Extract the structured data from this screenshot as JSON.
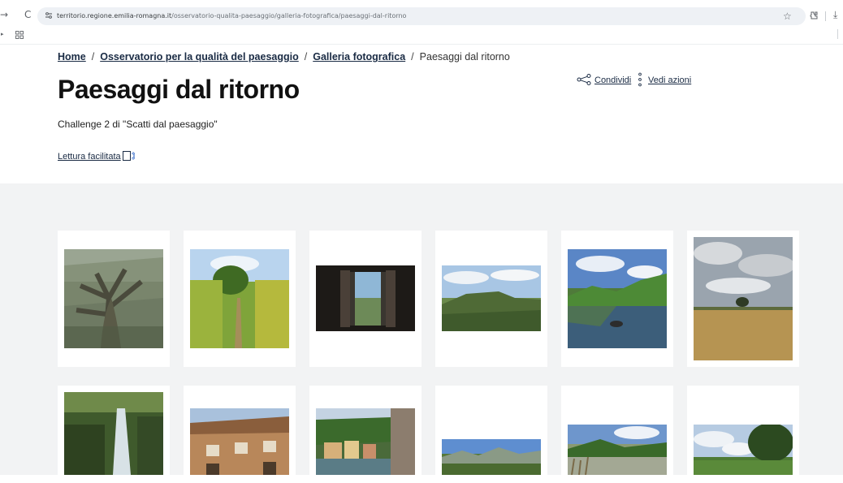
{
  "browser": {
    "back_glyph": "→",
    "reload_glyph": "C",
    "url_host": "territorio.regione.emilia-romagna.it",
    "url_path": "/osservatorio-qualita-paesaggio/galleria-fotografica/paesaggi-dal-ritorno",
    "bookmark_glyph": "☆",
    "download_glyph": "⤓",
    "icons": [
      "site-info-icon",
      "bookmark-star-icon",
      "extensions-icon",
      "download-icon",
      "apps-grid-icon"
    ]
  },
  "breadcrumb": {
    "items": [
      "Home",
      "Osservatorio per la qualità del paesaggio",
      "Galleria fotografica"
    ],
    "separator": "/",
    "current": "Paesaggi dal ritorno"
  },
  "page": {
    "title": "Paesaggi dal ritorno",
    "subtitle": "Challenge 2 di \"Scatti dal paesaggio\"",
    "easy_read": "Lettura facilitata",
    "share_label": "Condividi",
    "actions_label": "Vedi azioni"
  },
  "gallery": {
    "photos": [
      {
        "subject": "ancient tree in forest"
      },
      {
        "subject": "grassy path with hedges"
      },
      {
        "subject": "view through open window"
      },
      {
        "subject": "hills under cloudy sky"
      },
      {
        "subject": "lake reflecting mountains"
      },
      {
        "subject": "wheat field with lone tree"
      },
      {
        "subject": "waterfall in woods"
      },
      {
        "subject": "building facade looking up"
      },
      {
        "subject": "village with river"
      },
      {
        "subject": "valley and mountains"
      },
      {
        "subject": "river with reeds"
      },
      {
        "subject": "meadow with trees"
      }
    ]
  },
  "colors": {
    "link": "#1a2b44",
    "gallery_bg": "#f2f3f4"
  }
}
